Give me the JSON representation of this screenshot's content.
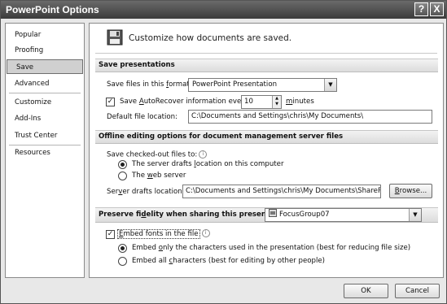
{
  "window": {
    "title": "PowerPoint Options",
    "help_label": "?",
    "close_label": "X"
  },
  "sidebar": {
    "items": [
      {
        "label": "Popular"
      },
      {
        "label": "Proofing"
      },
      {
        "label": "Save",
        "selected": true
      },
      {
        "label": "Advanced"
      },
      {
        "label": "Customize"
      },
      {
        "label": "Add-Ins"
      },
      {
        "label": "Trust Center"
      },
      {
        "label": "Resources"
      }
    ]
  },
  "header": {
    "text": "Customize how documents are saved.",
    "icon": "floppy-disk-icon"
  },
  "save_presentations": {
    "heading": "Save presentations",
    "format_label_pre": "Save files in this ",
    "format_label_u": "f",
    "format_label_post": "ormat:",
    "format_value": "PowerPoint Presentation",
    "autorecover_checked": true,
    "autorecover_pre": "Save ",
    "autorecover_u": "A",
    "autorecover_post": "utoRecover information every",
    "autorecover_minutes": "10",
    "minutes_label_u": "m",
    "minutes_label_post": "inutes",
    "default_location_pre": "Default f",
    "default_location_u": "i",
    "default_location_post": "le location:",
    "default_location_value": "C:\\Documents and Settings\\chris\\My Documents\\"
  },
  "offline": {
    "heading": "Offline editing options for document management server files",
    "checked_out_label": "Save checked-out files to:",
    "option_server_drafts_pre": "The server drafts ",
    "option_server_drafts_u": "l",
    "option_server_drafts_post": "ocation on this computer",
    "option_server_drafts_selected": true,
    "option_web_server_pre": "The ",
    "option_web_server_u": "w",
    "option_web_server_post": "eb server",
    "drafts_location_pre": "Ser",
    "drafts_location_u": "v",
    "drafts_location_post": "er drafts location:",
    "drafts_location_value": "C:\\Documents and Settings\\chris\\My Documents\\SharePoint Drafts\\",
    "browse_pre": "",
    "browse_u": "B",
    "browse_post": "rowse..."
  },
  "fidelity": {
    "heading_pre": "Preserve fi",
    "heading_u": "d",
    "heading_post": "elity when sharing this presentation:",
    "presentation_value": "FocusGroup07",
    "embed_fonts_checked": true,
    "embed_fonts_pre": "",
    "embed_fonts_u": "E",
    "embed_fonts_post": "mbed fonts in the file",
    "embed_only_pre": "Embed ",
    "embed_only_u": "o",
    "embed_only_post": "nly the characters used in the presentation (best for reducing file size)",
    "embed_only_selected": true,
    "embed_all_pre": "Embed all ",
    "embed_all_u": "c",
    "embed_all_post": "haracters (best for editing by other people)",
    "embed_all_selected": false
  },
  "footer": {
    "ok_label": "OK",
    "cancel_label": "Cancel"
  }
}
